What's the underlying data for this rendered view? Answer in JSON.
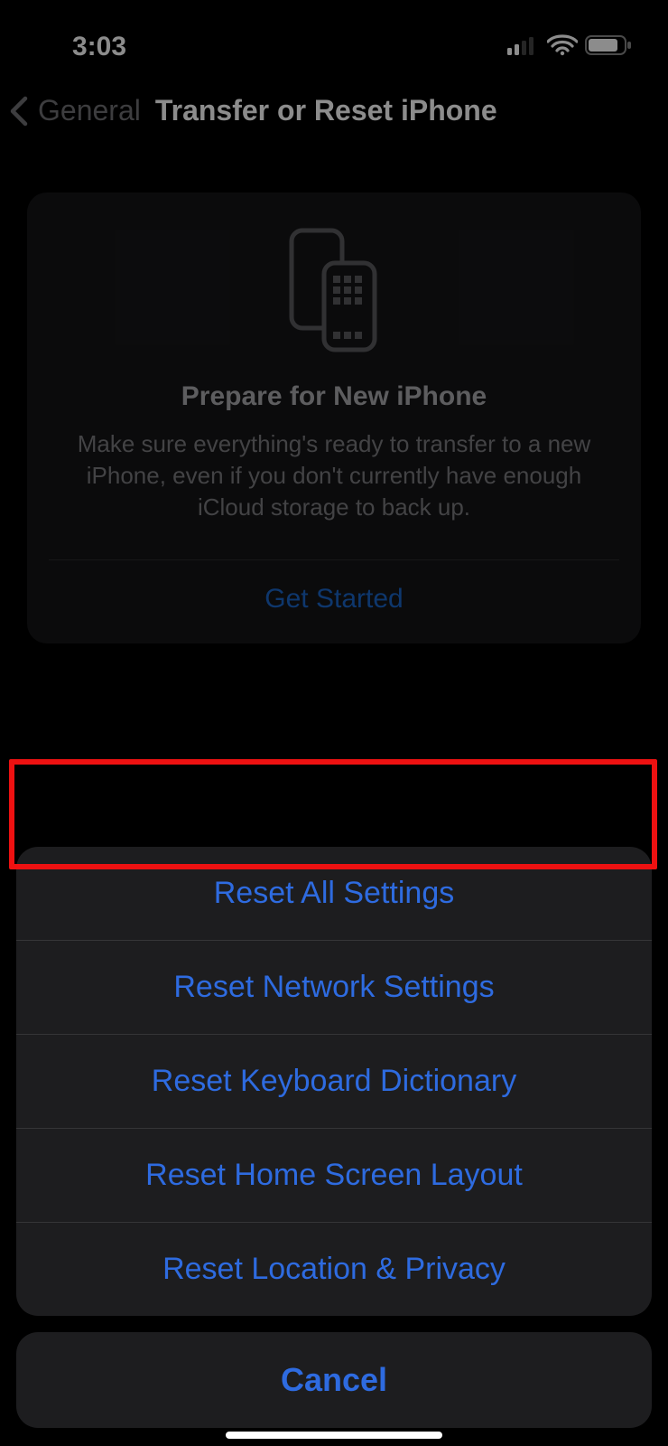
{
  "status": {
    "time": "3:03"
  },
  "nav": {
    "back_label": "General",
    "title": "Transfer or Reset iPhone"
  },
  "card": {
    "title": "Prepare for New iPhone",
    "body": "Make sure everything's ready to transfer to a new iPhone, even if you don't currently have enough iCloud storage to back up.",
    "cta": "Get Started"
  },
  "sheet": {
    "items": [
      "Reset All Settings",
      "Reset Network Settings",
      "Reset Keyboard Dictionary",
      "Reset Home Screen Layout",
      "Reset Location & Privacy"
    ],
    "cancel": "Cancel"
  },
  "highlight_index": 0
}
